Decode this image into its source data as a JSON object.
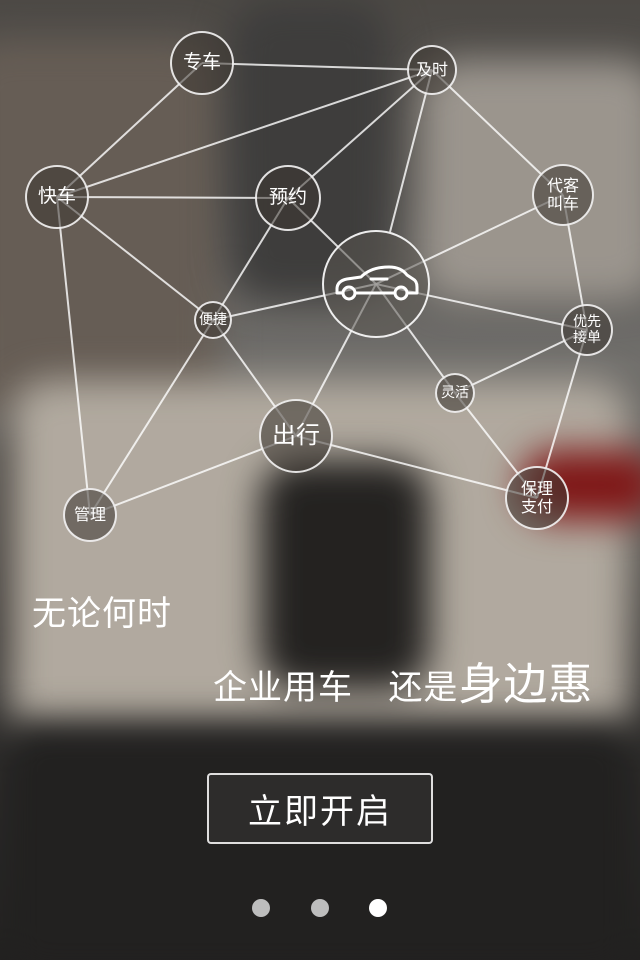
{
  "nodes": {
    "zhuanche": "专车",
    "jishi": "及时",
    "kuaiche": "快车",
    "yuyue": "预约",
    "daike_1": "代客",
    "daike_2": "叫车",
    "bianjie": "便捷",
    "youxian_1": "优先",
    "youxian_2": "接单",
    "linghuo": "灵活",
    "chuxing": "出行",
    "guanli": "管理",
    "baoli_1": "保理",
    "baoli_2": "支付"
  },
  "center_icon": "car-icon",
  "slogan": {
    "line1": "无论何时",
    "line2_a": "企业用车",
    "line2_b": "还是",
    "line2_highlight": "身边惠"
  },
  "start_button": "立即开启",
  "pager": {
    "total": 3,
    "active": 3
  }
}
